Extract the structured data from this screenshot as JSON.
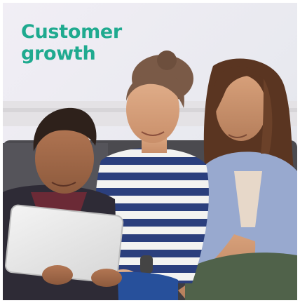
{
  "card": {
    "headline_line1": "Customer",
    "headline_line2": "growth",
    "headline_color": "#1faa8f"
  },
  "photo": {
    "subject": "woman-with-two-children-looking-at-tablet-on-sofa"
  }
}
